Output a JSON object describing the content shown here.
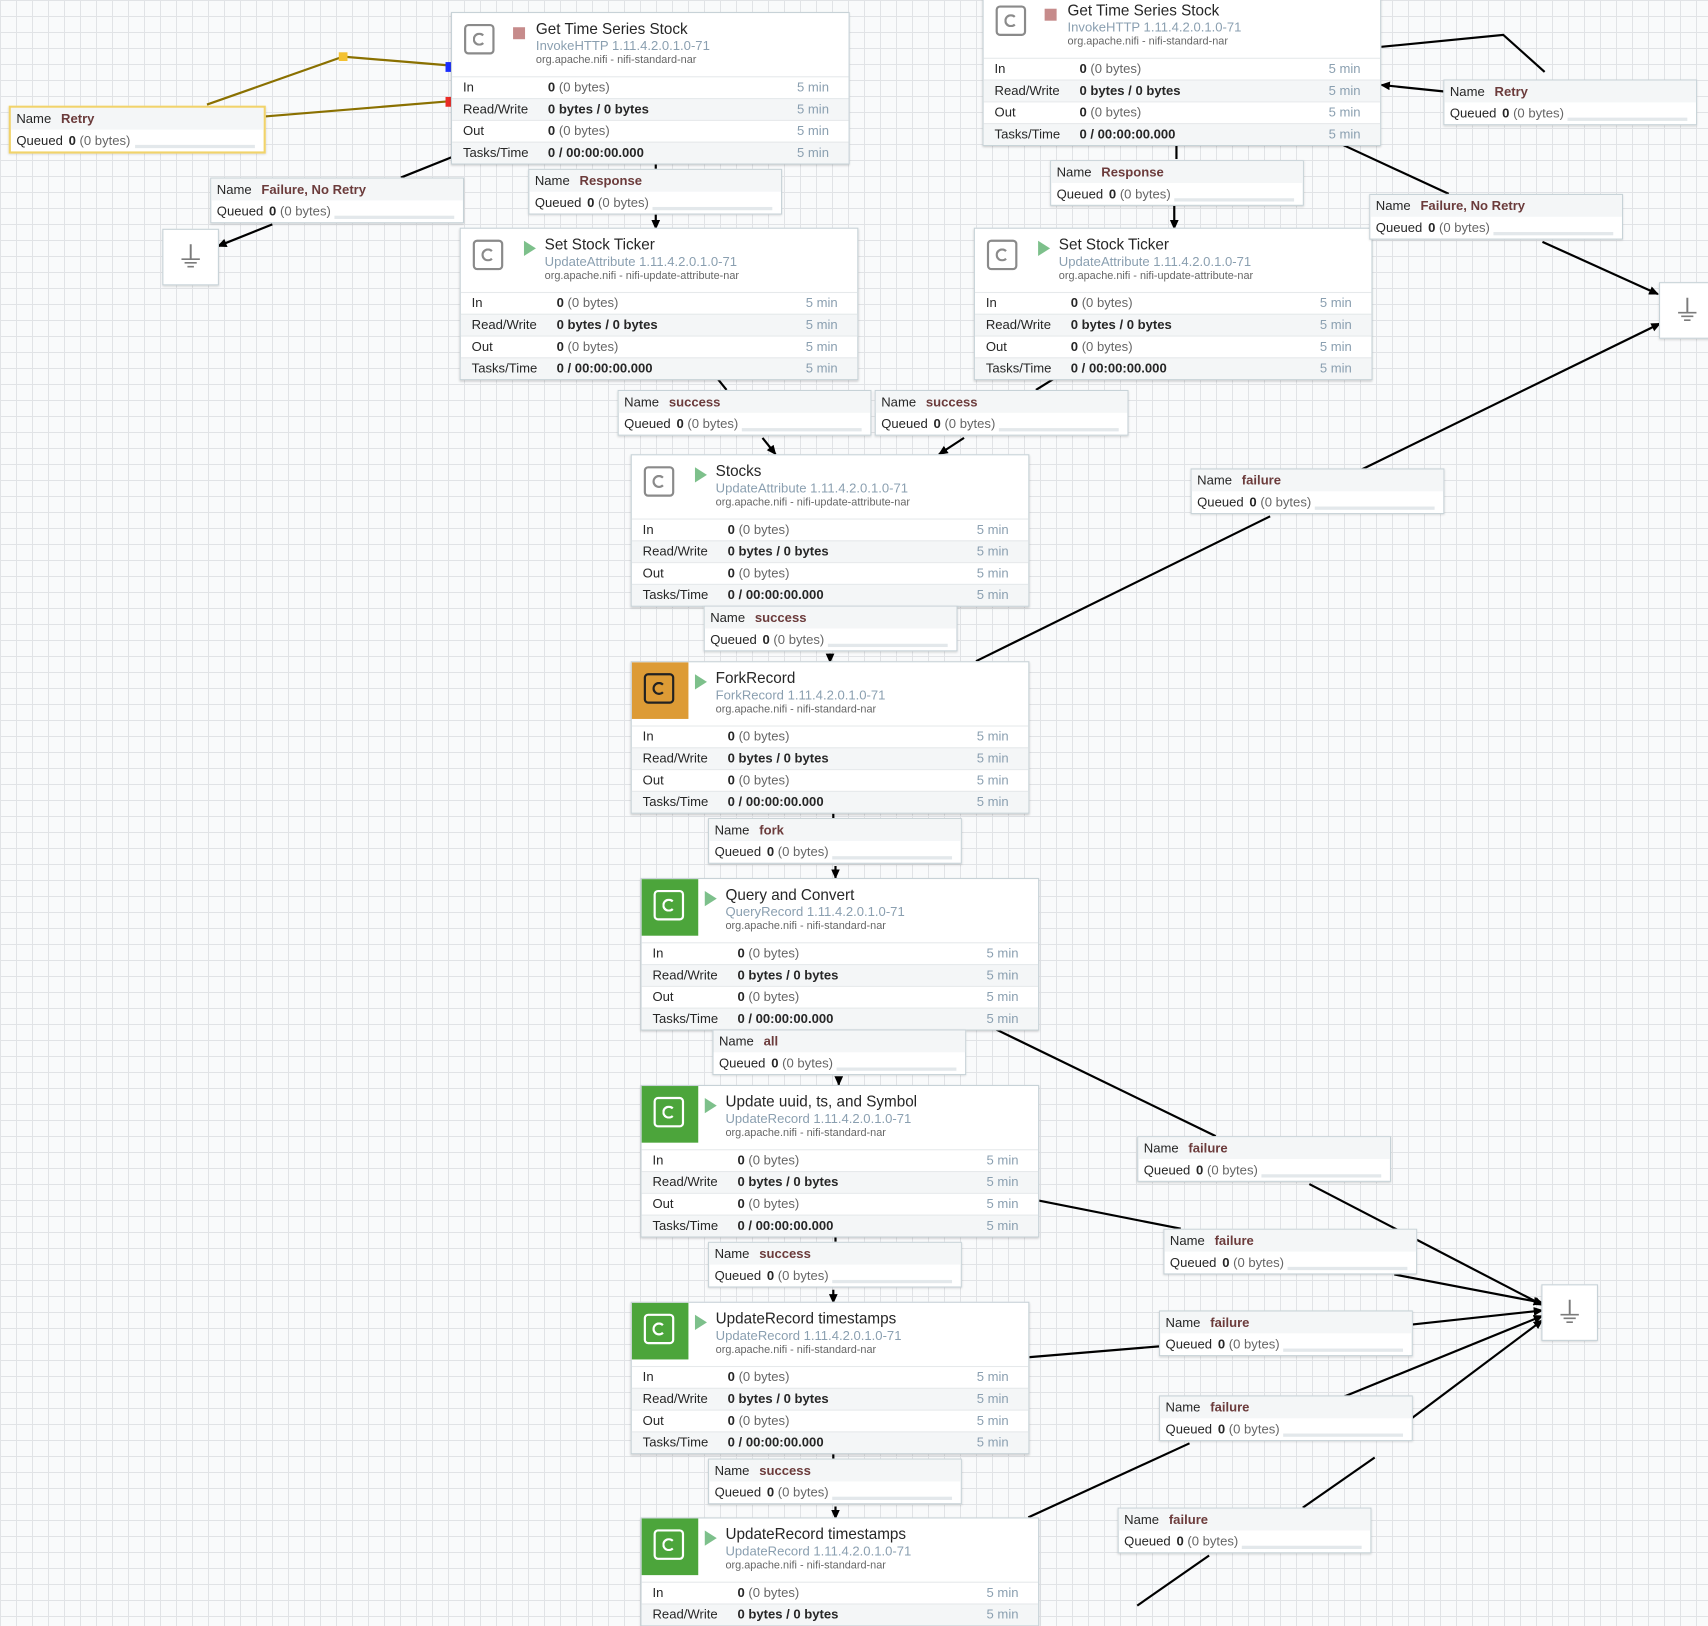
{
  "processors": [
    {
      "id": "p1",
      "name": "Get Time Series Stock",
      "type": "InvokeHTTP 1.11.4.2.0.1.0-71",
      "bundle": "org.apache.nifi - nifi-standard-nar",
      "state": "stopped",
      "icon": "processor-icon",
      "stats": [
        {
          "label": "In",
          "value": "0",
          "extra": "(0 bytes)",
          "time": "5 min"
        },
        {
          "label": "Read/Write",
          "value": "0 bytes / 0 bytes",
          "extra": "",
          "time": "5 min"
        },
        {
          "label": "Out",
          "value": "0",
          "extra": "(0 bytes)",
          "time": "5 min"
        },
        {
          "label": "Tasks/Time",
          "value": "0 / 00:00:00.000",
          "extra": "",
          "time": "5 min"
        }
      ]
    },
    {
      "id": "p2",
      "name": "Get Time Series Stock",
      "type": "InvokeHTTP 1.11.4.2.0.1.0-71",
      "bundle": "org.apache.nifi - nifi-standard-nar",
      "state": "stopped",
      "icon": "processor-icon",
      "stats": [
        {
          "label": "In",
          "value": "0",
          "extra": "(0 bytes)",
          "time": "5 min"
        },
        {
          "label": "Read/Write",
          "value": "0 bytes / 0 bytes",
          "extra": "",
          "time": "5 min"
        },
        {
          "label": "Out",
          "value": "0",
          "extra": "(0 bytes)",
          "time": "5 min"
        },
        {
          "label": "Tasks/Time",
          "value": "0 / 00:00:00.000",
          "extra": "",
          "time": "5 min"
        }
      ]
    },
    {
      "id": "p3",
      "name": "Set Stock Ticker",
      "type": "UpdateAttribute 1.11.4.2.0.1.0-71",
      "bundle": "org.apache.nifi - nifi-update-attribute-nar",
      "state": "running",
      "icon": "processor-icon",
      "stats": [
        {
          "label": "In",
          "value": "0",
          "extra": "(0 bytes)",
          "time": "5 min"
        },
        {
          "label": "Read/Write",
          "value": "0 bytes / 0 bytes",
          "extra": "",
          "time": "5 min"
        },
        {
          "label": "Out",
          "value": "0",
          "extra": "(0 bytes)",
          "time": "5 min"
        },
        {
          "label": "Tasks/Time",
          "value": "0 / 00:00:00.000",
          "extra": "",
          "time": "5 min"
        }
      ]
    },
    {
      "id": "p4",
      "name": "Set Stock Ticker",
      "type": "UpdateAttribute 1.11.4.2.0.1.0-71",
      "bundle": "org.apache.nifi - nifi-update-attribute-nar",
      "state": "running",
      "icon": "processor-icon",
      "stats": [
        {
          "label": "In",
          "value": "0",
          "extra": "(0 bytes)",
          "time": "5 min"
        },
        {
          "label": "Read/Write",
          "value": "0 bytes / 0 bytes",
          "extra": "",
          "time": "5 min"
        },
        {
          "label": "Out",
          "value": "0",
          "extra": "(0 bytes)",
          "time": "5 min"
        },
        {
          "label": "Tasks/Time",
          "value": "0 / 00:00:00.000",
          "extra": "",
          "time": "5 min"
        }
      ]
    },
    {
      "id": "p5",
      "name": "Stocks",
      "type": "UpdateAttribute 1.11.4.2.0.1.0-71",
      "bundle": "org.apache.nifi - nifi-update-attribute-nar",
      "state": "running",
      "icon": "processor-icon",
      "stats": [
        {
          "label": "In",
          "value": "0",
          "extra": "(0 bytes)",
          "time": "5 min"
        },
        {
          "label": "Read/Write",
          "value": "0 bytes / 0 bytes",
          "extra": "",
          "time": "5 min"
        },
        {
          "label": "Out",
          "value": "0",
          "extra": "(0 bytes)",
          "time": "5 min"
        },
        {
          "label": "Tasks/Time",
          "value": "0 / 00:00:00.000",
          "extra": "",
          "time": "5 min"
        }
      ]
    },
    {
      "id": "p6",
      "name": "ForkRecord",
      "type": "ForkRecord 1.11.4.2.0.1.0-71",
      "bundle": "org.apache.nifi - nifi-standard-nar",
      "state": "running",
      "icon": "processor-icon",
      "stats": [
        {
          "label": "In",
          "value": "0",
          "extra": "(0 bytes)",
          "time": "5 min"
        },
        {
          "label": "Read/Write",
          "value": "0 bytes / 0 bytes",
          "extra": "",
          "time": "5 min"
        },
        {
          "label": "Out",
          "value": "0",
          "extra": "(0 bytes)",
          "time": "5 min"
        },
        {
          "label": "Tasks/Time",
          "value": "0 / 00:00:00.000",
          "extra": "",
          "time": "5 min"
        }
      ]
    },
    {
      "id": "p7",
      "name": "Query and Convert",
      "type": "QueryRecord 1.11.4.2.0.1.0-71",
      "bundle": "org.apache.nifi - nifi-standard-nar",
      "state": "running",
      "icon": "processor-icon",
      "stats": [
        {
          "label": "In",
          "value": "0",
          "extra": "(0 bytes)",
          "time": "5 min"
        },
        {
          "label": "Read/Write",
          "value": "0 bytes / 0 bytes",
          "extra": "",
          "time": "5 min"
        },
        {
          "label": "Out",
          "value": "0",
          "extra": "(0 bytes)",
          "time": "5 min"
        },
        {
          "label": "Tasks/Time",
          "value": "0 / 00:00:00.000",
          "extra": "",
          "time": "5 min"
        }
      ]
    },
    {
      "id": "p8",
      "name": "Update uuid, ts, and Symbol",
      "type": "UpdateRecord 1.11.4.2.0.1.0-71",
      "bundle": "org.apache.nifi - nifi-standard-nar",
      "state": "running",
      "icon": "processor-icon",
      "stats": [
        {
          "label": "In",
          "value": "0",
          "extra": "(0 bytes)",
          "time": "5 min"
        },
        {
          "label": "Read/Write",
          "value": "0 bytes / 0 bytes",
          "extra": "",
          "time": "5 min"
        },
        {
          "label": "Out",
          "value": "0",
          "extra": "(0 bytes)",
          "time": "5 min"
        },
        {
          "label": "Tasks/Time",
          "value": "0 / 00:00:00.000",
          "extra": "",
          "time": "5 min"
        }
      ]
    },
    {
      "id": "p9",
      "name": "UpdateRecord timestamps",
      "type": "UpdateRecord 1.11.4.2.0.1.0-71",
      "bundle": "org.apache.nifi - nifi-standard-nar",
      "state": "running",
      "icon": "processor-icon",
      "stats": [
        {
          "label": "In",
          "value": "0",
          "extra": "(0 bytes)",
          "time": "5 min"
        },
        {
          "label": "Read/Write",
          "value": "0 bytes / 0 bytes",
          "extra": "",
          "time": "5 min"
        },
        {
          "label": "Out",
          "value": "0",
          "extra": "(0 bytes)",
          "time": "5 min"
        },
        {
          "label": "Tasks/Time",
          "value": "0 / 00:00:00.000",
          "extra": "",
          "time": "5 min"
        }
      ]
    },
    {
      "id": "p10",
      "name": "UpdateRecord timestamps",
      "type": "UpdateRecord 1.11.4.2.0.1.0-71",
      "bundle": "org.apache.nifi - nifi-standard-nar",
      "state": "running",
      "icon": "processor-icon",
      "stats": [
        {
          "label": "In",
          "value": "0",
          "extra": "(0 bytes)",
          "time": "5 min"
        },
        {
          "label": "Read/Write",
          "value": "0 bytes / 0 bytes",
          "extra": "",
          "time": "5 min"
        }
      ]
    }
  ],
  "connections": [
    {
      "id": "c1",
      "name_label": "Name",
      "name": "Retry",
      "queued_label": "Queued",
      "queued": "0",
      "queued_bytes": "(0 bytes)"
    },
    {
      "id": "c2",
      "name_label": "Name",
      "name": "Failure, No Retry",
      "queued_label": "Queued",
      "queued": "0",
      "queued_bytes": "(0 bytes)"
    },
    {
      "id": "c3",
      "name_label": "Name",
      "name": "Response",
      "queued_label": "Queued",
      "queued": "0",
      "queued_bytes": "(0 bytes)"
    },
    {
      "id": "c4",
      "name_label": "Name",
      "name": "Response",
      "queued_label": "Queued",
      "queued": "0",
      "queued_bytes": "(0 bytes)"
    },
    {
      "id": "c5",
      "name_label": "Name",
      "name": "Retry",
      "queued_label": "Queued",
      "queued": "0",
      "queued_bytes": "(0 bytes)"
    },
    {
      "id": "c6",
      "name_label": "Name",
      "name": "Failure, No Retry",
      "queued_label": "Queued",
      "queued": "0",
      "queued_bytes": "(0 bytes)"
    },
    {
      "id": "c7",
      "name_label": "Name",
      "name": "success",
      "queued_label": "Queued",
      "queued": "0",
      "queued_bytes": "(0 bytes)"
    },
    {
      "id": "c8",
      "name_label": "Name",
      "name": "success",
      "queued_label": "Queued",
      "queued": "0",
      "queued_bytes": "(0 bytes)"
    },
    {
      "id": "c9",
      "name_label": "Name",
      "name": "failure",
      "queued_label": "Queued",
      "queued": "0",
      "queued_bytes": "(0 bytes)"
    },
    {
      "id": "c10",
      "name_label": "Name",
      "name": "success",
      "queued_label": "Queued",
      "queued": "0",
      "queued_bytes": "(0 bytes)"
    },
    {
      "id": "c11",
      "name_label": "Name",
      "name": "fork",
      "queued_label": "Queued",
      "queued": "0",
      "queued_bytes": "(0 bytes)"
    },
    {
      "id": "c12",
      "name_label": "Name",
      "name": "all",
      "queued_label": "Queued",
      "queued": "0",
      "queued_bytes": "(0 bytes)"
    },
    {
      "id": "c13",
      "name_label": "Name",
      "name": "failure",
      "queued_label": "Queued",
      "queued": "0",
      "queued_bytes": "(0 bytes)"
    },
    {
      "id": "c14",
      "name_label": "Name",
      "name": "success",
      "queued_label": "Queued",
      "queued": "0",
      "queued_bytes": "(0 bytes)"
    },
    {
      "id": "c15",
      "name_label": "Name",
      "name": "failure",
      "queued_label": "Queued",
      "queued": "0",
      "queued_bytes": "(0 bytes)"
    },
    {
      "id": "c16",
      "name_label": "Name",
      "name": "failure",
      "queued_label": "Queued",
      "queued": "0",
      "queued_bytes": "(0 bytes)"
    },
    {
      "id": "c17",
      "name_label": "Name",
      "name": "success",
      "queued_label": "Queued",
      "queued": "0",
      "queued_bytes": "(0 bytes)"
    },
    {
      "id": "c18",
      "name_label": "Name",
      "name": "failure",
      "queued_label": "Queued",
      "queued": "0",
      "queued_bytes": "(0 bytes)"
    },
    {
      "id": "c19",
      "name_label": "Name",
      "name": "failure",
      "queued_label": "Queued",
      "queued": "0",
      "queued_bytes": "(0 bytes)"
    }
  ],
  "funnels": [
    {
      "id": "f1",
      "icon": "funnel-icon"
    },
    {
      "id": "f2",
      "icon": "funnel-icon"
    },
    {
      "id": "f3",
      "icon": "funnel-icon"
    }
  ],
  "colors": {
    "running": "#7dc08b",
    "stopped": "#c68b8b",
    "fork_icon_bg": "#dd9b35",
    "record_icon_bg": "#4ca53b",
    "selected_connection": "#f1d36b"
  }
}
